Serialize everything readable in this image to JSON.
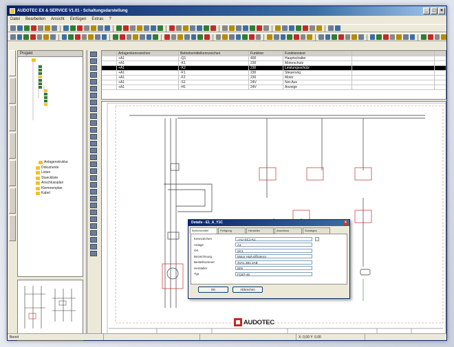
{
  "window": {
    "title": "AUDOTEC EX & SERVICE V1.01 - Schaltungsdarstellung"
  },
  "menu": [
    "Datei",
    "Bearbeiten",
    "Ansicht",
    "Einfügen",
    "Extras",
    "?"
  ],
  "grid": {
    "headers": [
      "",
      "Anlagenkennzeichen",
      "Betriebsmittelkennzeichen",
      "Funktion",
      "Funktionstext",
      ""
    ],
    "rows": [
      [
        "",
        "+A1",
        "-Q1",
        "400",
        "Hauptschalter",
        ""
      ],
      [
        "",
        "+A1",
        "-K1",
        "230",
        "Motorschutz",
        ""
      ],
      [
        "",
        "+A1",
        "-K2",
        "230",
        "Leistungsschütz",
        ""
      ],
      [
        "",
        "+A1",
        "-F1",
        "230",
        "Steuerung",
        ""
      ],
      [
        "",
        "+A1",
        "-F2",
        "230",
        "Motor",
        ""
      ],
      [
        "",
        "+A1",
        "-S1",
        "24V",
        "Not-Aus",
        ""
      ],
      [
        "",
        "+A1",
        "-H1",
        "24V",
        "Anzeige",
        ""
      ]
    ],
    "selected_row": 2
  },
  "tree": {
    "header": "Projekt",
    "items": [
      "Anlagenstruktur",
      "Dokumente",
      "Listen",
      "Stueckliste",
      "Anschlussplan",
      "Klemmenplan",
      "Kabel"
    ]
  },
  "dialog": {
    "title": "Details - E1_A_Y1C",
    "tabs": [
      "Betriebsmittel",
      "Fertigung",
      "Hersteller",
      "Anschluss",
      "Sonstiges"
    ],
    "fields": [
      {
        "label": "Kennzeichen",
        "value": "=A1+SC1-K1"
      },
      {
        "label": "Anlage",
        "value": "A1"
      },
      {
        "label": "Ort",
        "value": "SC1"
      },
      {
        "label": "Bezeichnung",
        "value": "Motor High Efficiency"
      },
      {
        "label": "Bestellnummer",
        "value": "3VA1 2B1 2AB"
      },
      {
        "label": "Hersteller",
        "value": "DIN"
      },
      {
        "label": "Typ",
        "value": "FCBT-46"
      }
    ],
    "ok_label": "OK",
    "cancel_label": "Abbrechen"
  },
  "logo_text": "AUDOTEC",
  "status": [
    "Bereit",
    "",
    "",
    "X: 0,00 Y: 0,00"
  ],
  "colors": {
    "title_bar": "#0a246a",
    "accent_red": "#c62828",
    "schematic_red": "#e57373",
    "tree_green": "#2e7d32",
    "tree_folder": "#f3c21c"
  }
}
